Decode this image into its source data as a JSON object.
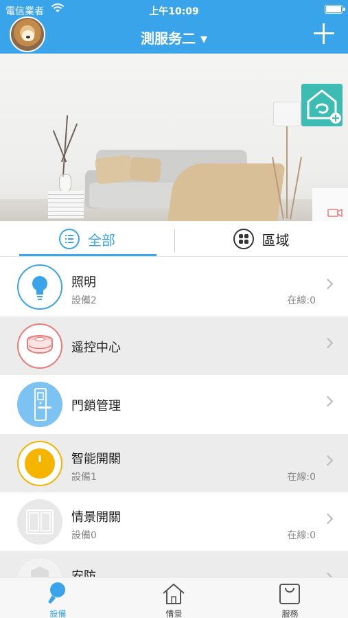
{
  "status_bar": {
    "carrier": "電信業者",
    "time": "上午10:09"
  },
  "header": {
    "title": "測服务二 ▾"
  },
  "segments": {
    "all": "全部",
    "area": "區域"
  },
  "categories": [
    {
      "name": "照明",
      "device_count": "設備2",
      "online": "在線:0"
    },
    {
      "name": "遥控中心",
      "device_count": "",
      "online": ""
    },
    {
      "name": "門鎖管理",
      "device_count": "",
      "online": ""
    },
    {
      "name": "智能開關",
      "device_count": "設備1",
      "online": "在線:0"
    },
    {
      "name": "情景開關",
      "device_count": "設備0",
      "online": "在線:0"
    },
    {
      "name": "安防",
      "device_count": "",
      "online": ""
    }
  ],
  "tabbar": {
    "devices": "設備",
    "scenes": "情景",
    "services": "服務"
  },
  "colors": {
    "accent": "#3aa4ea",
    "teal": "#3dbcb4",
    "yellow": "#f5b400",
    "red": "#e87b7b"
  }
}
